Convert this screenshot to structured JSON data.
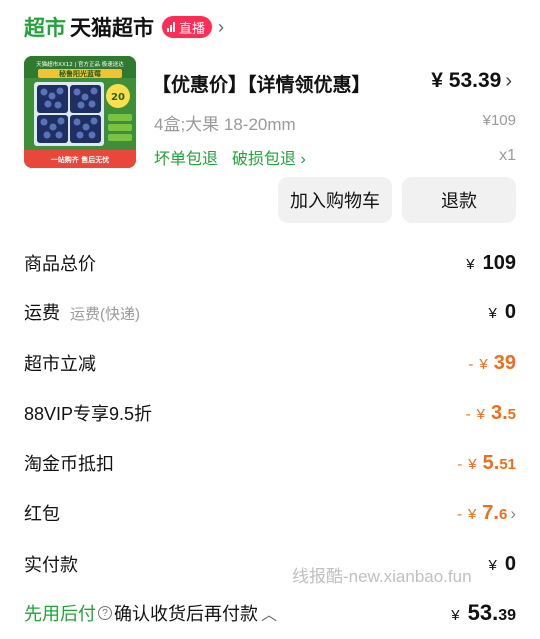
{
  "store": {
    "brand": "超市",
    "name": "天猫超市",
    "live_label": "直播",
    "chevron": "›"
  },
  "product": {
    "title": "【优惠价】【详情领优惠】",
    "price": "¥ 53.39",
    "price_chevron": "›",
    "spec": "4盒;大果 18-20mm",
    "original_price": "¥109",
    "tags": [
      "坏单包退",
      "破损包退 ›"
    ],
    "quantity": "x1",
    "image": {
      "caption_top": "天猫超市XX12 | 官方正品 极速送达",
      "caption_mid": "秘鲁阳光蓝莓",
      "caption_bottom": "一站购齐 售后无忧",
      "badge": "20"
    }
  },
  "actions": {
    "add_to_cart": "加入购物车",
    "refund": "退款"
  },
  "fees": [
    {
      "label": "商品总价",
      "sublabel": "",
      "currency": "¥",
      "sign": "",
      "amount": "109",
      "tail": "",
      "discount": false,
      "chevron": ""
    },
    {
      "label": "运费",
      "sublabel": "运费(快递)",
      "currency": "¥",
      "sign": "",
      "amount": "0",
      "tail": "",
      "discount": false,
      "chevron": ""
    },
    {
      "label": "超市立减",
      "sublabel": "",
      "currency": "¥",
      "sign": "-",
      "amount": "39",
      "tail": "",
      "discount": true,
      "chevron": ""
    },
    {
      "label": "88VIP专享9.5折",
      "sublabel": "",
      "currency": "¥",
      "sign": "-",
      "amount": "3.",
      "tail": "5",
      "discount": true,
      "chevron": ""
    },
    {
      "label": "淘金币抵扣",
      "sublabel": "",
      "currency": "¥",
      "sign": "-",
      "amount": "5.",
      "tail": "51",
      "discount": true,
      "chevron": ""
    },
    {
      "label": "红包",
      "sublabel": "",
      "currency": "¥",
      "sign": "-",
      "amount": "7.",
      "tail": "6",
      "discount": true,
      "chevron": "›"
    },
    {
      "label": "实付款",
      "sublabel": "",
      "currency": "¥",
      "sign": "",
      "amount": "0",
      "tail": "",
      "discount": false,
      "chevron": ""
    }
  ],
  "bottom": {
    "bnpl": "先用后付",
    "help_icon": "?",
    "confirm_text": "确认收货后再付款",
    "chevron_up": "︿",
    "total_currency": "¥",
    "total_int": "53.",
    "total_dec": "39"
  },
  "watermark": "线报酷-new.xianbao.fun",
  "colors": {
    "brand_green": "#23a23a",
    "discount_orange": "#ef6d1b",
    "live_red": "#ff2d55",
    "button_bg": "#f1f1f1",
    "muted_gray": "#9a9a9a"
  }
}
